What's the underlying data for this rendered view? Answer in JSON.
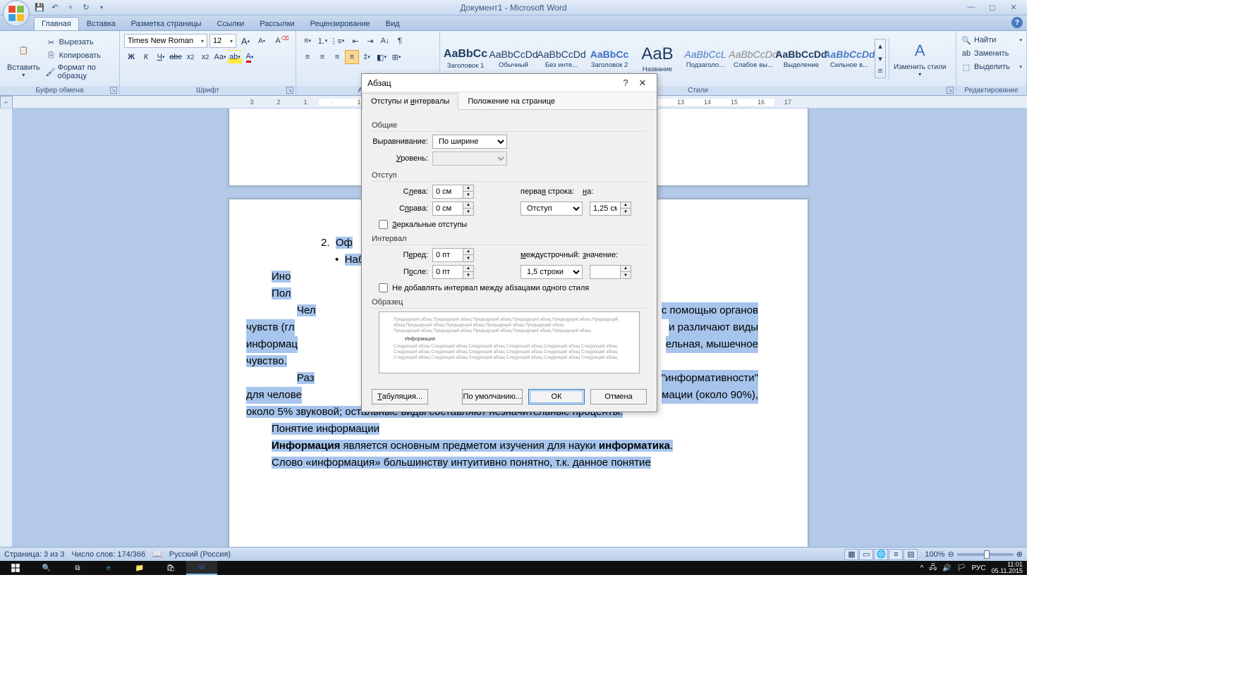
{
  "app": {
    "title": "Документ1 - Microsoft Word"
  },
  "qat": {
    "save": "💾",
    "undo": "↶",
    "redo": "↷"
  },
  "tabs": {
    "items": [
      "Главная",
      "Вставка",
      "Разметка страницы",
      "Ссылки",
      "Рассылки",
      "Рецензирование",
      "Вид"
    ],
    "active": 0
  },
  "ribbon": {
    "clipboard": {
      "label": "Буфер обмена",
      "paste": "Вставить",
      "cut": "Вырезать",
      "copy": "Копировать",
      "format_painter": "Формат по образцу"
    },
    "font": {
      "label": "Шрифт",
      "name": "Times New Roman",
      "size": "12"
    },
    "paragraph": {
      "label": "Абзац"
    },
    "styles": {
      "label": "Стили",
      "items": [
        {
          "sample": "AaBbCc",
          "name": "Заголовок 1",
          "color": "#1f3a5f",
          "bold": true
        },
        {
          "sample": "AaBbCcDd",
          "name": "Обычный",
          "color": "#000"
        },
        {
          "sample": "AaBbCcDd",
          "name": "Без инте...",
          "color": "#000"
        },
        {
          "sample": "AaBbCc",
          "name": "Заголовок 2",
          "color": "#1f5fbf",
          "bold": true
        },
        {
          "sample": "AaB",
          "name": "Название",
          "color": "#1f3a5f",
          "big": true
        },
        {
          "sample": "AaBbCcL",
          "name": "Подзаголо...",
          "color": "#4a7ac4",
          "italic": true
        },
        {
          "sample": "AaBbCcDd",
          "name": "Слабое вы...",
          "color": "#888",
          "italic": true
        },
        {
          "sample": "AaBbCcDd",
          "name": "Выделение",
          "color": "#000",
          "bold": true
        },
        {
          "sample": "AaBbCcDd",
          "name": "Сильное в...",
          "color": "#4a7ac4",
          "bold": true,
          "italic": true
        }
      ],
      "change": "Изменить стили"
    },
    "editing": {
      "label": "Редактирование",
      "find": "Найти",
      "replace": "Заменить",
      "select": "Выделить"
    }
  },
  "dialog": {
    "title": "Абзац",
    "tab1": "Отступы и интервалы",
    "tab2": "Положение на странице",
    "section_general": "Общие",
    "alignment_label": "Выравнивание:",
    "alignment_value": "По ширине",
    "level_label": "Уровень:",
    "level_value": "",
    "section_indent": "Отступ",
    "left_label": "Слева:",
    "left_value": "0 см",
    "right_label": "Справа:",
    "right_value": "0 см",
    "firstline_label": "первая строка:",
    "firstline_value": "Отступ",
    "by1_label": "на:",
    "by1_value": "1,25 см",
    "mirror": "Зеркальные отступы",
    "section_spacing": "Интервал",
    "before_label": "Перед:",
    "before_value": "0 пт",
    "after_label": "После:",
    "after_value": "0 пт",
    "linespacing_label": "междустрочный:",
    "linespacing_value": "1,5 строки",
    "by2_label": "значение:",
    "by2_value": "",
    "noadd": "Не добавлять интервал между абзацами одного стиля",
    "section_preview": "Образец",
    "preview_filler": "Предыдущий абзац Предыдущий абзац Предыдущий абзац Предыдущий абзац Предыдущий абзац",
    "preview_main": "Информация",
    "preview_filler2": "Следующий абзац Следующий абзац Следующий абзац Следующий абзац Следующий абзац Следующий абзац",
    "btn_tabs": "Табуляция...",
    "btn_default": "По умолчанию...",
    "btn_ok": "ОК",
    "btn_cancel": "Отмена"
  },
  "document": {
    "li2_num": "2.",
    "li2_text": "Оф",
    "bullet_text": "Наб",
    "p1": "Ино",
    "p2": "Пол",
    "p3a": "Чел",
    "p3b": "с помощью органов",
    "p4a": "чувств (гл",
    "p4b": "и различают виды",
    "p5a": "информац",
    "p5b": "ельная, мышечное",
    "p6": "чувство.",
    "p7a": "Раз",
    "p7b": "\"информативности\"",
    "p8a": "для челове",
    "p8b": "мации (около 90%),",
    "p9": "около 5% звуковой; остальные виды составляют незначительные проценты.",
    "p10": "Понятие информации",
    "p11a": "Информация",
    "p11b": " является основным предметом изучения для науки ",
    "p11c": "информатика",
    "p12": "Слово «информация» большинству интуитивно понятно, т.к. данное понятие"
  },
  "status": {
    "page": "Страница: 3 из 3",
    "words": "Число слов: 174/366",
    "lang": "Русский (Россия)",
    "zoom": "100%"
  },
  "taskbar": {
    "lang": "РУС",
    "time": "11:01",
    "date": "05.11.2015"
  }
}
